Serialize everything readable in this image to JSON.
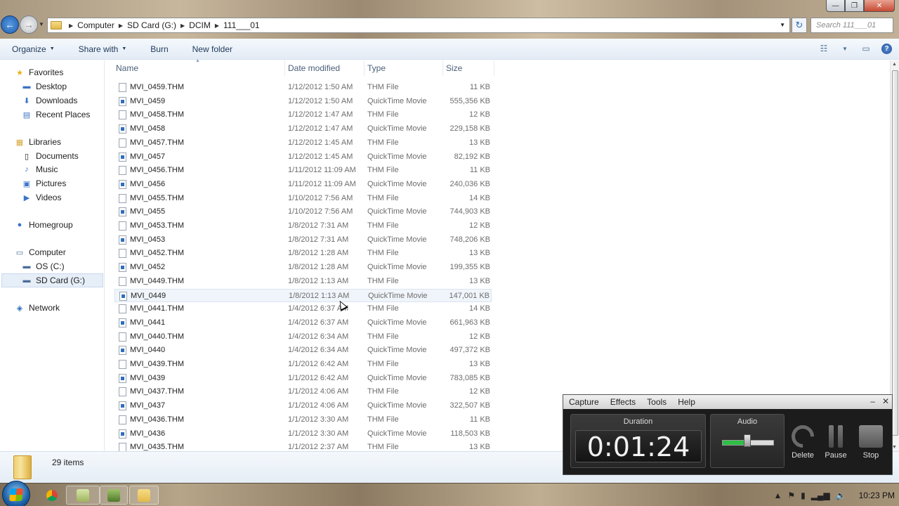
{
  "window": {
    "controls": {
      "minimize": "—",
      "maximize": "❐",
      "close": "✕"
    }
  },
  "nav": {
    "back_icon": "←",
    "forward_icon": "→",
    "breadcrumb": [
      "Computer",
      "SD Card (G:)",
      "DCIM",
      "111___01"
    ],
    "search_placeholder": "Search 111___01",
    "refresh_icon": "↻"
  },
  "toolbar": {
    "organize": "Organize",
    "share_with": "Share with",
    "burn": "Burn",
    "new_folder": "New folder"
  },
  "sidebar": {
    "favorites": {
      "label": "Favorites",
      "items": [
        "Desktop",
        "Downloads",
        "Recent Places"
      ]
    },
    "libraries": {
      "label": "Libraries",
      "items": [
        "Documents",
        "Music",
        "Pictures",
        "Videos"
      ]
    },
    "homegroup": "Homegroup",
    "computer": {
      "label": "Computer",
      "items": [
        "OS (C:)",
        "SD Card (G:)"
      ]
    },
    "network": "Network",
    "selected": "SD Card (G:)"
  },
  "columns": {
    "name": "Name",
    "date": "Date modified",
    "type": "Type",
    "size": "Size"
  },
  "files": [
    {
      "name": "MVI_0459.THM",
      "date": "1/12/2012 1:50 AM",
      "type": "THM File",
      "size": "11 KB",
      "movie": false
    },
    {
      "name": "MVI_0459",
      "date": "1/12/2012 1:50 AM",
      "type": "QuickTime Movie",
      "size": "555,356 KB",
      "movie": true
    },
    {
      "name": "MVI_0458.THM",
      "date": "1/12/2012 1:47 AM",
      "type": "THM File",
      "size": "12 KB",
      "movie": false
    },
    {
      "name": "MVI_0458",
      "date": "1/12/2012 1:47 AM",
      "type": "QuickTime Movie",
      "size": "229,158 KB",
      "movie": true
    },
    {
      "name": "MVI_0457.THM",
      "date": "1/12/2012 1:45 AM",
      "type": "THM File",
      "size": "13 KB",
      "movie": false
    },
    {
      "name": "MVI_0457",
      "date": "1/12/2012 1:45 AM",
      "type": "QuickTime Movie",
      "size": "82,192 KB",
      "movie": true
    },
    {
      "name": "MVI_0456.THM",
      "date": "1/11/2012 11:09 AM",
      "type": "THM File",
      "size": "11 KB",
      "movie": false
    },
    {
      "name": "MVI_0456",
      "date": "1/11/2012 11:09 AM",
      "type": "QuickTime Movie",
      "size": "240,036 KB",
      "movie": true
    },
    {
      "name": "MVI_0455.THM",
      "date": "1/10/2012 7:56 AM",
      "type": "THM File",
      "size": "14 KB",
      "movie": false
    },
    {
      "name": "MVI_0455",
      "date": "1/10/2012 7:56 AM",
      "type": "QuickTime Movie",
      "size": "744,903 KB",
      "movie": true
    },
    {
      "name": "MVI_0453.THM",
      "date": "1/8/2012 7:31 AM",
      "type": "THM File",
      "size": "12 KB",
      "movie": false
    },
    {
      "name": "MVI_0453",
      "date": "1/8/2012 7:31 AM",
      "type": "QuickTime Movie",
      "size": "748,206 KB",
      "movie": true
    },
    {
      "name": "MVI_0452.THM",
      "date": "1/8/2012 1:28 AM",
      "type": "THM File",
      "size": "13 KB",
      "movie": false
    },
    {
      "name": "MVI_0452",
      "date": "1/8/2012 1:28 AM",
      "type": "QuickTime Movie",
      "size": "199,355 KB",
      "movie": true
    },
    {
      "name": "MVI_0449.THM",
      "date": "1/8/2012 1:13 AM",
      "type": "THM File",
      "size": "13 KB",
      "movie": false
    },
    {
      "name": "MVI_0449",
      "date": "1/8/2012 1:13 AM",
      "type": "QuickTime Movie",
      "size": "147,001 KB",
      "movie": true,
      "hover": true
    },
    {
      "name": "MVI_0441.THM",
      "date": "1/4/2012 6:37 AM",
      "type": "THM File",
      "size": "14 KB",
      "movie": false
    },
    {
      "name": "MVI_0441",
      "date": "1/4/2012 6:37 AM",
      "type": "QuickTime Movie",
      "size": "661,963 KB",
      "movie": true
    },
    {
      "name": "MVI_0440.THM",
      "date": "1/4/2012 6:34 AM",
      "type": "THM File",
      "size": "12 KB",
      "movie": false
    },
    {
      "name": "MVI_0440",
      "date": "1/4/2012 6:34 AM",
      "type": "QuickTime Movie",
      "size": "497,372 KB",
      "movie": true
    },
    {
      "name": "MVI_0439.THM",
      "date": "1/1/2012 6:42 AM",
      "type": "THM File",
      "size": "13 KB",
      "movie": false
    },
    {
      "name": "MVI_0439",
      "date": "1/1/2012 6:42 AM",
      "type": "QuickTime Movie",
      "size": "783,085 KB",
      "movie": true
    },
    {
      "name": "MVI_0437.THM",
      "date": "1/1/2012 4:06 AM",
      "type": "THM File",
      "size": "12 KB",
      "movie": false
    },
    {
      "name": "MVI_0437",
      "date": "1/1/2012 4:06 AM",
      "type": "QuickTime Movie",
      "size": "322,507 KB",
      "movie": true
    },
    {
      "name": "MVI_0436.THM",
      "date": "1/1/2012 3:30 AM",
      "type": "THM File",
      "size": "11 KB",
      "movie": false
    },
    {
      "name": "MVI_0436",
      "date": "1/1/2012 3:30 AM",
      "type": "QuickTime Movie",
      "size": "118,503 KB",
      "movie": true
    },
    {
      "name": "MVI_0435.THM",
      "date": "1/1/2012 2:37 AM",
      "type": "THM File",
      "size": "13 KB",
      "movie": false
    }
  ],
  "details": {
    "item_count": "29 items"
  },
  "capture": {
    "menu": [
      "Capture",
      "Effects",
      "Tools",
      "Help"
    ],
    "minimize": "–",
    "close": "✕",
    "duration_label": "Duration",
    "duration_value": "0:01:24",
    "audio_label": "Audio",
    "audio_level": 0.48,
    "buttons": {
      "delete": "Delete",
      "pause": "Pause",
      "stop": "Stop"
    }
  },
  "taskbar": {
    "clock": "10:23 PM"
  }
}
